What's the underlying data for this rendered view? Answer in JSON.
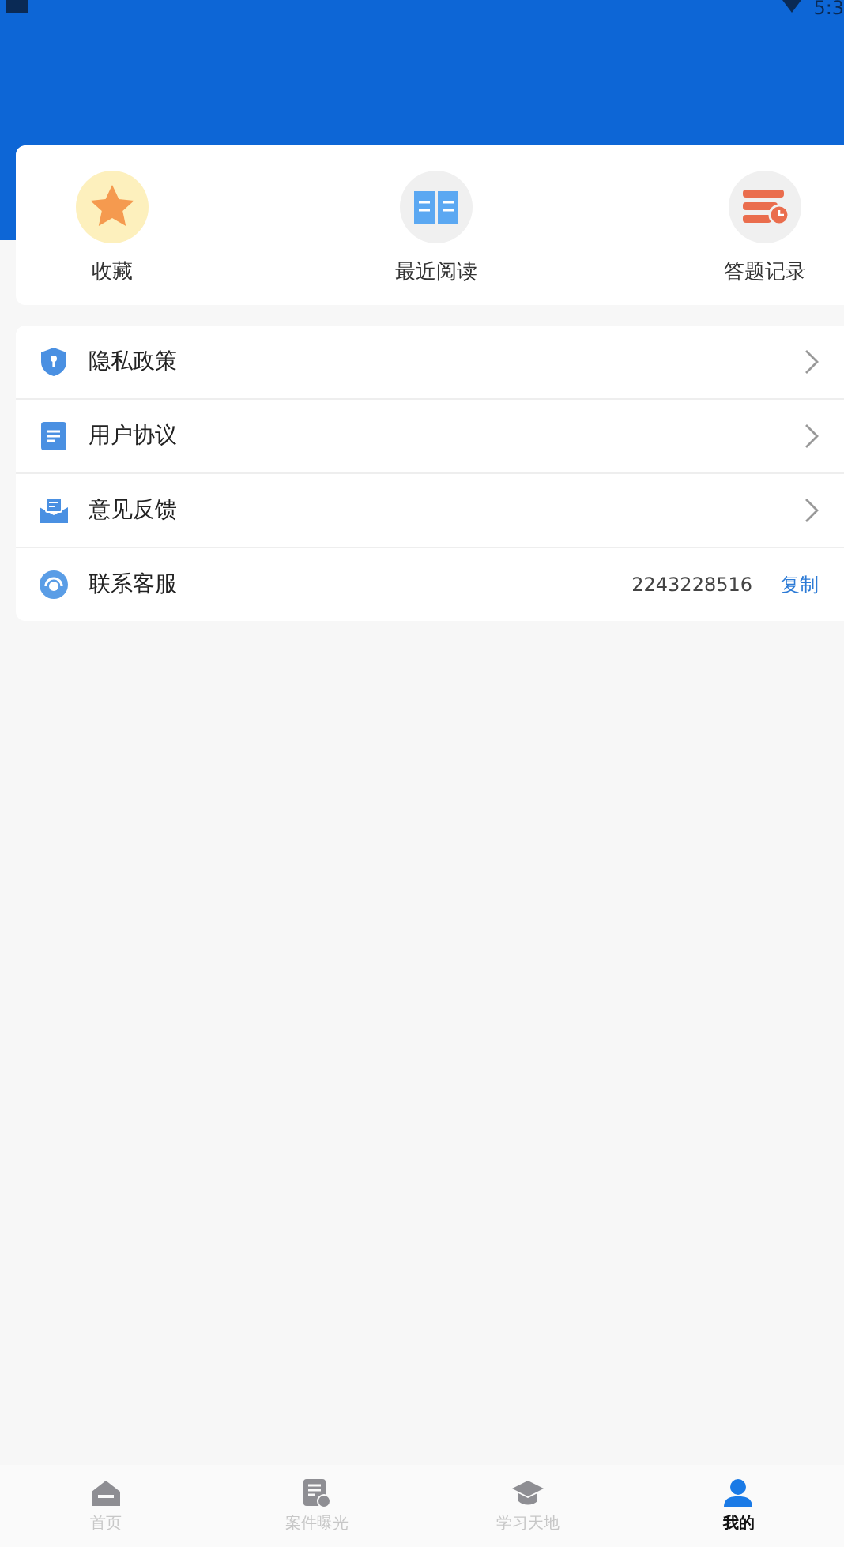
{
  "status_bar": {
    "time": "5:3"
  },
  "shortcuts": [
    {
      "kind": "star",
      "label": "收藏"
    },
    {
      "kind": "book",
      "label": "最近阅读"
    },
    {
      "kind": "record",
      "label": "答题记录"
    }
  ],
  "menu": [
    {
      "kind": "shield",
      "label": "隐私政策"
    },
    {
      "kind": "doc",
      "label": "用户协议"
    },
    {
      "kind": "mail",
      "label": "意见反馈"
    },
    {
      "kind": "service",
      "label": "联系客服",
      "value": "2243228516",
      "action": "复制"
    }
  ],
  "tabs": [
    {
      "kind": "home",
      "label": "首页",
      "selected": false
    },
    {
      "kind": "cases",
      "label": "案件曝光",
      "selected": false
    },
    {
      "kind": "study",
      "label": "学习天地",
      "selected": false
    },
    {
      "kind": "me",
      "label": "我的",
      "selected": true
    }
  ]
}
